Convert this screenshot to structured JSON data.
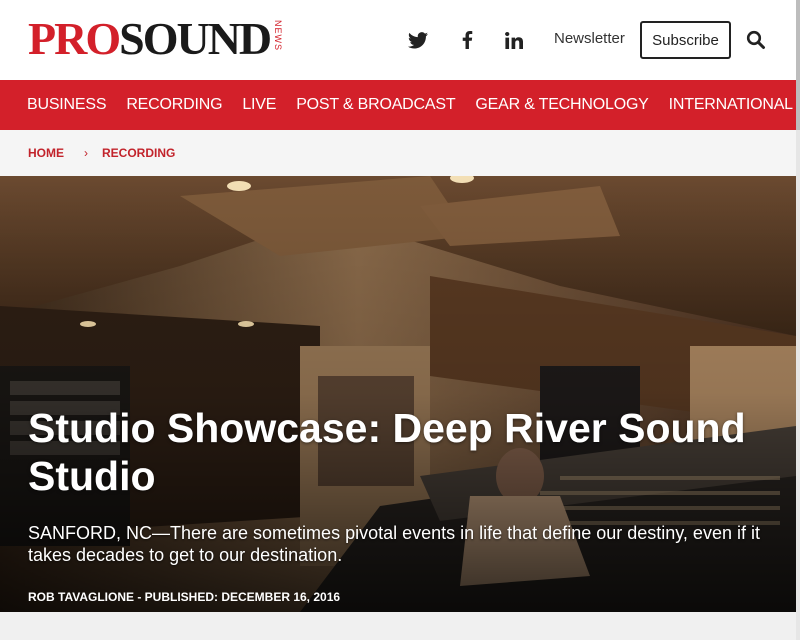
{
  "brand": {
    "logo_pro": "PRO",
    "logo_sound": "SOUND",
    "logo_news": "NEWS",
    "red": "#d3202a",
    "dark": "#1a1a1a"
  },
  "header": {
    "social_icons": [
      "twitter-icon",
      "facebook-icon",
      "linkedin-icon"
    ],
    "newsletter_label": "Newsletter",
    "subscribe_label": "Subscribe",
    "search_icon": "search-icon"
  },
  "nav": {
    "background": "#d3202a",
    "items": [
      {
        "label": "BUSINESS"
      },
      {
        "label": "RECORDING"
      },
      {
        "label": "LIVE"
      },
      {
        "label": "POST & BROADCAST"
      },
      {
        "label": "GEAR & TECHNOLOGY"
      },
      {
        "label": "INTERNATIONAL"
      }
    ]
  },
  "breadcrumb": {
    "home": "HOME",
    "separator": "›",
    "current": "RECORDING",
    "color": "#c2232b"
  },
  "article": {
    "title": "Studio Showcase: Deep River Sound Studio",
    "dek": "SANFORD, NC—There are sometimes pivotal events in life that define our destiny, even if it takes decades to get to our destination.",
    "byline": "ROB TAVAGLIONE - PUBLISHED: DECEMBER 16, 2016"
  }
}
